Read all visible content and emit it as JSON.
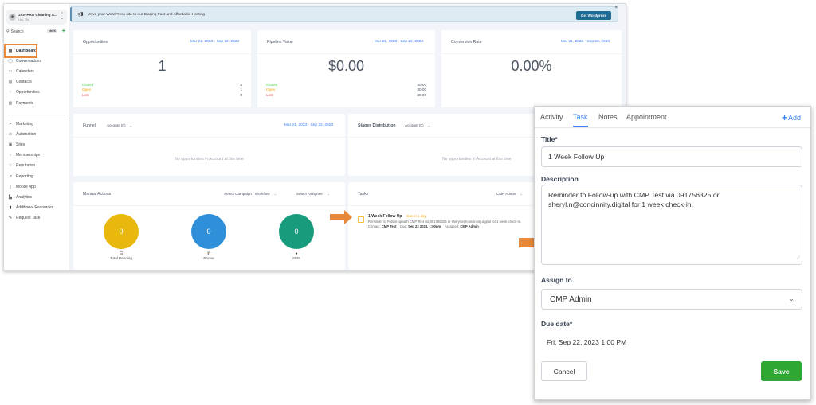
{
  "sidebar": {
    "account_name": "JAN-PRO Cleaning &...",
    "account_location": "Ltd, TN",
    "search_label": "Search",
    "search_shortcut": "ctrl K",
    "items": [
      {
        "label": "Dashboard",
        "icon": "grid-icon",
        "active": true
      },
      {
        "label": "Conversations",
        "icon": "chat-icon"
      },
      {
        "label": "Calendars",
        "icon": "calendar-icon"
      },
      {
        "label": "Contacts",
        "icon": "contacts-icon"
      },
      {
        "label": "Opportunities",
        "icon": "funnel-icon"
      },
      {
        "label": "Payments",
        "icon": "payments-icon"
      }
    ],
    "items2": [
      {
        "label": "Marketing",
        "icon": "send-icon"
      },
      {
        "label": "Automation",
        "icon": "automation-icon"
      },
      {
        "label": "Sites",
        "icon": "sites-icon"
      },
      {
        "label": "Memberships",
        "icon": "award-icon"
      },
      {
        "label": "Reputation",
        "icon": "star-icon"
      },
      {
        "label": "Reporting",
        "icon": "trend-icon"
      },
      {
        "label": "Mobile App",
        "icon": "mobile-icon"
      },
      {
        "label": "Analytics",
        "icon": "analytics-icon"
      },
      {
        "label": "Additional Resources",
        "icon": "bookmark-icon"
      },
      {
        "label": "Request Task",
        "icon": "request-icon"
      }
    ]
  },
  "banner": {
    "text": "Move your WordPress site to our Blazing Fast and Affordable Hosting",
    "button": "Get Wordpress",
    "close": "×"
  },
  "cards": {
    "opportunities": {
      "title": "Opportunities",
      "date": "Mar 21, 2023 - Sep 22, 2023",
      "value": "1",
      "rows": [
        {
          "label": "Closed",
          "value": "0"
        },
        {
          "label": "Open",
          "value": "1"
        },
        {
          "label": "Lost",
          "value": "0"
        }
      ]
    },
    "pipeline": {
      "title": "Pipeline Value",
      "date": "Mar 21, 2023 - Sep 22, 2023",
      "value": "$0.00",
      "rows": [
        {
          "label": "Closed",
          "value": "$0.00"
        },
        {
          "label": "Open",
          "value": "$0.00"
        },
        {
          "label": "Lost",
          "value": "$0.00"
        }
      ]
    },
    "conversion": {
      "title": "Conversion Rate",
      "date": "Mar 21, 2023 - Sep 22, 2023",
      "value": "0.00%"
    },
    "funnel": {
      "title": "Funnel",
      "dropdown": "Account (0)",
      "date": "Mar 21, 2023 - Sep 22, 2023",
      "empty": "No opportunities in Account at this time"
    },
    "stages": {
      "title": "Stages Distribution",
      "dropdown": "Account (0)",
      "empty": "No opportunities in Account at this time"
    },
    "manual": {
      "title": "Manual Actions",
      "campaign_dropdown": "Select Campaign / Workflow",
      "assignee_dropdown": "Select Assignee",
      "circles": [
        {
          "value": "0",
          "label": "Total Pending",
          "color": "#e8b80f",
          "icon": "☷"
        },
        {
          "value": "0",
          "label": "Phone",
          "color": "#2f8fd8",
          "icon": "✆"
        },
        {
          "value": "0",
          "label": "SMS",
          "color": "#189a7c",
          "icon": "●"
        }
      ]
    },
    "tasks": {
      "title": "Tasks",
      "dropdown": "CMP Admin",
      "task": {
        "title": "1 Week Follow Up",
        "due_badge": "Due in 1 day",
        "description": "Reminder to Follow-up with CMP Test via 091756325 or sheryl.n@concinnity.digital for 1 week check-in.",
        "contact_label": "Contact:",
        "contact": "CMP Test",
        "due_label": "Due:",
        "due": "Sep 22 2023, 1:00pm",
        "assigned_label": "Assigned:",
        "assigned": "CMP Admin"
      }
    }
  },
  "panel": {
    "tabs": [
      "Activity",
      "Task",
      "Notes",
      "Appointment"
    ],
    "active_tab": "Task",
    "add_label": "Add",
    "title_label": "Title*",
    "title_value": "1 Week Follow Up",
    "description_label": "Description",
    "description_value": "Reminder to Follow-up with  CMP Test via  091756325 or sheryl.n@concinnity.digital for 1 week check-in.",
    "assign_label": "Assign to",
    "assign_value": "CMP Admin",
    "due_label": "Due date*",
    "due_value": "Fri, Sep 22, 2023 1:00 PM",
    "cancel": "Cancel",
    "save": "Save"
  },
  "colors": {
    "accent": "#3b82f6",
    "annotation": "#e8883a",
    "save": "#2ea832"
  }
}
